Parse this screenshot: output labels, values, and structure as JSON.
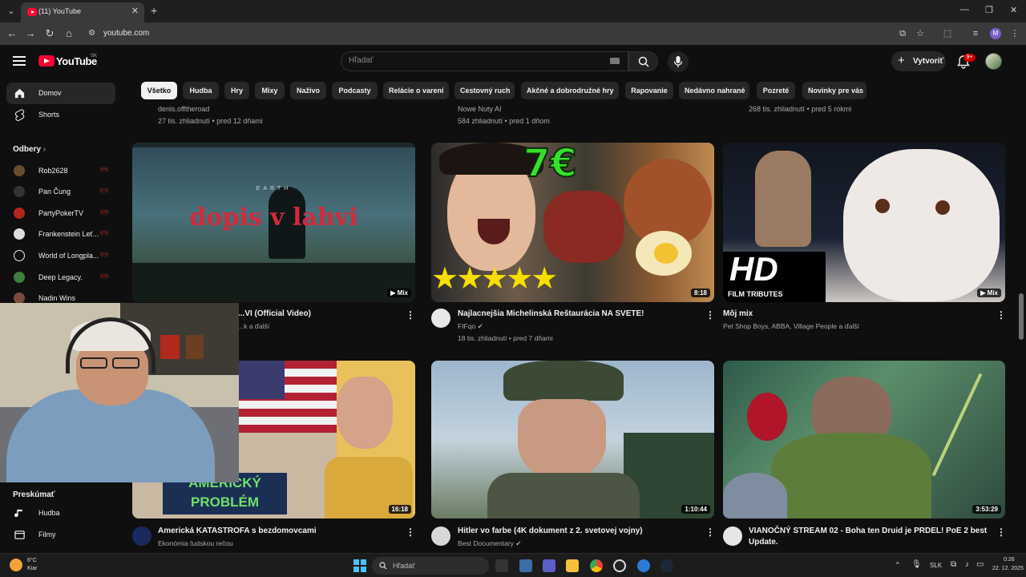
{
  "browser": {
    "tab_title": "(11) YouTube",
    "url": "youtube.com",
    "profile_initial": "M"
  },
  "header": {
    "logo_text": "YouTube",
    "country_code": "SK",
    "search_placeholder": "Hľadať",
    "create_label": "Vytvoriť",
    "notif_count": "9+"
  },
  "sidebar": {
    "nav": [
      {
        "label": "Domov",
        "icon": "home-icon",
        "active": true
      },
      {
        "label": "Shorts",
        "icon": "shorts-icon",
        "active": false
      }
    ],
    "subs_title": "Odbery",
    "subscriptions": [
      "Rob2628",
      "Pan Čung",
      "PartyPokerTV",
      "Frankenstein Leť...",
      "World of Longpla...",
      "Deep Legacy.",
      "Nadin Wins"
    ],
    "explore_title": "Preskúmať",
    "explore": [
      {
        "label": "Hudba",
        "icon": "music-icon"
      },
      {
        "label": "Filmy",
        "icon": "film-icon"
      }
    ]
  },
  "chips": [
    "Všetko",
    "Hudba",
    "Hry",
    "Mixy",
    "Naživo",
    "Podcasty",
    "Relácie o varení",
    "Cestovný ruch",
    "Akčné a dobrodružné hry",
    "Rapovanie",
    "Nedávno nahrané",
    "Pozreté",
    "Novinky pre vás"
  ],
  "top_partial": [
    {
      "channel": "denis.offtheroad",
      "meta": "27 tis. zhliadnutí • pred 12 dňami"
    },
    {
      "channel": "Nowe Nuty AI",
      "meta": "584 zhliadnutí • pred 1 dňom"
    },
    {
      "channel": "",
      "meta": "268 tis. zhliadnutí • pred 5 rokmi"
    }
  ],
  "videos_row1": [
    {
      "title": "...VI (Official Video)",
      "sub": "...k a ďalší",
      "meta": "",
      "badge": "Mix",
      "thumb_text": "dopis v lahvi",
      "thumb_small": "EARTH"
    },
    {
      "title": "Najlacnejšia Michelinská Reštaurácia NA SVETE!",
      "sub": "FIFqo",
      "meta": "18 tis. zhliadnutí • pred 7 dňami",
      "badge": "8:18",
      "thumb_text": "7€"
    },
    {
      "title": "Môj mix",
      "sub": "Pet Shop Boys, ABBA, Village People a ďalší",
      "meta": "",
      "badge": "Mix",
      "thumb_text": "HD",
      "thumb_small": "FILM TRIBUTES"
    }
  ],
  "videos_row2": [
    {
      "title": "Americká KATASTROFA s bezdomovcami",
      "sub": "Ekonómia ľudskou rečou",
      "badge": "16:18",
      "thumb_text_1": "AMERICKÝ",
      "thumb_text_2": "PROBLÉM"
    },
    {
      "title": "Hitler vo farbe (4K dokument z 2. svetovej vojny)",
      "sub": "Best Documentary",
      "badge": "1:10:44"
    },
    {
      "title": "VIANOČNÝ STREAM 02 - Boha ten Druid je PRDEL! PoE 2 best Update.",
      "sub": "",
      "badge": "3:53:29"
    }
  ],
  "taskbar": {
    "search_label": "Hľadať",
    "weather_temp": "6°C",
    "weather_desc": "Kiar",
    "lang": "SLK",
    "time": "0:26",
    "date": "22. 12. 2025"
  }
}
